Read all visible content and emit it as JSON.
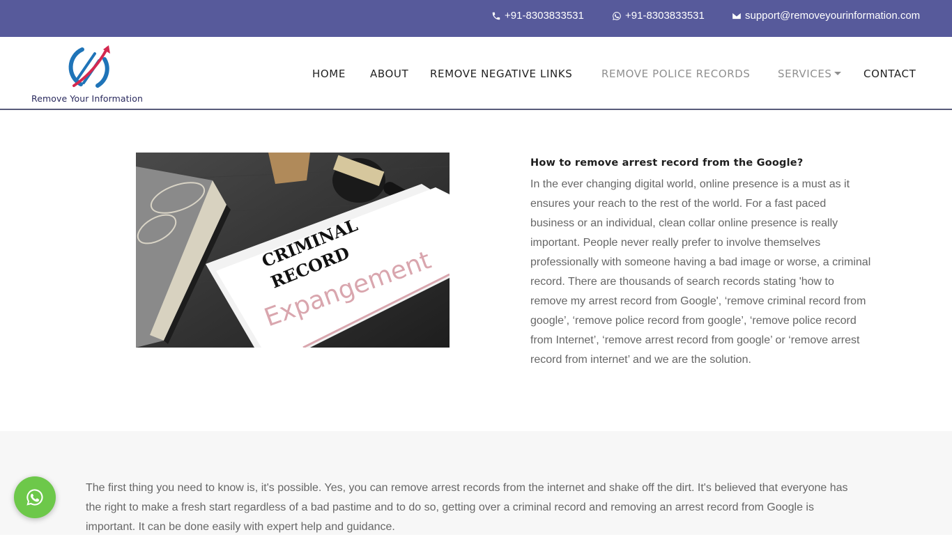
{
  "topbar": {
    "phone": "+91-8303833531",
    "whatsapp": "+91-8303833531",
    "email": "support@removeyourinformation.com",
    "icons": [
      "phone-icon",
      "whatsapp-icon",
      "envelope-icon"
    ]
  },
  "brand": {
    "name": "Remove Your Information",
    "colors": {
      "topbar": "#575a9b",
      "logo_blue": "#1f74b8",
      "logo_red": "#d4284f",
      "whatsapp_green": "#6dc84a"
    }
  },
  "nav": {
    "items": [
      {
        "label": "HOME",
        "state": "default"
      },
      {
        "label": "ABOUT",
        "state": "default"
      },
      {
        "label": "REMOVE NEGATIVE LINKS",
        "state": "default"
      },
      {
        "label": "REMOVE POLICE RECORDS",
        "state": "active"
      },
      {
        "label": "SERVICES",
        "state": "active",
        "has_dropdown": true
      },
      {
        "label": "CONTACT",
        "state": "default"
      }
    ]
  },
  "hero_image": {
    "alt": "Criminal Record Expangement document with gavel",
    "doc_title_line1": "CRIMINAL",
    "doc_title_line2": "RECORD",
    "handwriting": "Expangement"
  },
  "article": {
    "heading": "How to remove arrest record from the Google?",
    "body": "In the ever changing digital world, online presence is a must as it ensures your reach to the rest of the world. For a fast paced business or an individual, clean collar online presence is really important. People never really prefer to involve themselves professionally with someone having a bad image or worse, a criminal record. There are thousands of search records stating 'how to remove my arrest record from Google', ‘remove criminal record from google’, ‘remove police record from google’, ‘remove police record from Internet’, ‘remove arrest record from google’ or ‘remove arrest record from internet’ and we are the solution."
  },
  "section2": {
    "body": "The first thing you need to know is, it's possible. Yes, you can remove arrest records from the internet and shake off the dirt. It's believed that everyone has the right to make a fresh start regardless of a bad pastime and to do so, getting over a criminal record and removing an arrest record from Google is important. It can be done easily with expert help and guidance."
  },
  "floating_button": {
    "icon": "whatsapp-icon",
    "label": "Chat on WhatsApp"
  }
}
